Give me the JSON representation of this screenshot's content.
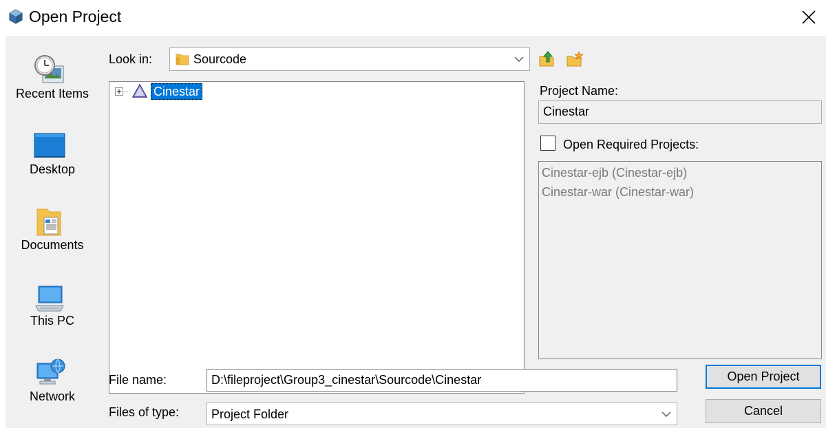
{
  "window": {
    "title": "Open Project",
    "icon": "netbeans-cube-icon"
  },
  "places": [
    {
      "label": "Recent Items",
      "icon": "recent-items-icon"
    },
    {
      "label": "Desktop",
      "icon": "desktop-icon"
    },
    {
      "label": "Documents",
      "icon": "documents-icon"
    },
    {
      "label": "This PC",
      "icon": "this-pc-icon"
    },
    {
      "label": "Network",
      "icon": "network-icon"
    }
  ],
  "look_in": {
    "label": "Look in:",
    "value": "Sourcode"
  },
  "toolbar": {
    "up_icon": "up-one-level-icon",
    "new_folder_icon": "new-folder-icon"
  },
  "file_list": {
    "items": [
      {
        "label": "Cinestar",
        "icon": "project-icon",
        "selected": true
      }
    ]
  },
  "project_name": {
    "label": "Project Name:",
    "value": "Cinestar"
  },
  "required_projects": {
    "label": "Open Required Projects:",
    "checked": false,
    "items": [
      "Cinestar-ejb (Cinestar-ejb)",
      "Cinestar-war (Cinestar-war)"
    ]
  },
  "file_name": {
    "label": "File name:",
    "value": "D:\\fileproject\\Group3_cinestar\\Sourcode\\Cinestar"
  },
  "file_type": {
    "label": "Files of type:",
    "value": "Project Folder"
  },
  "buttons": {
    "open": "Open Project",
    "cancel": "Cancel"
  },
  "colors": {
    "selection": "#0078d7",
    "dialog_bg": "#f0f0f0"
  }
}
